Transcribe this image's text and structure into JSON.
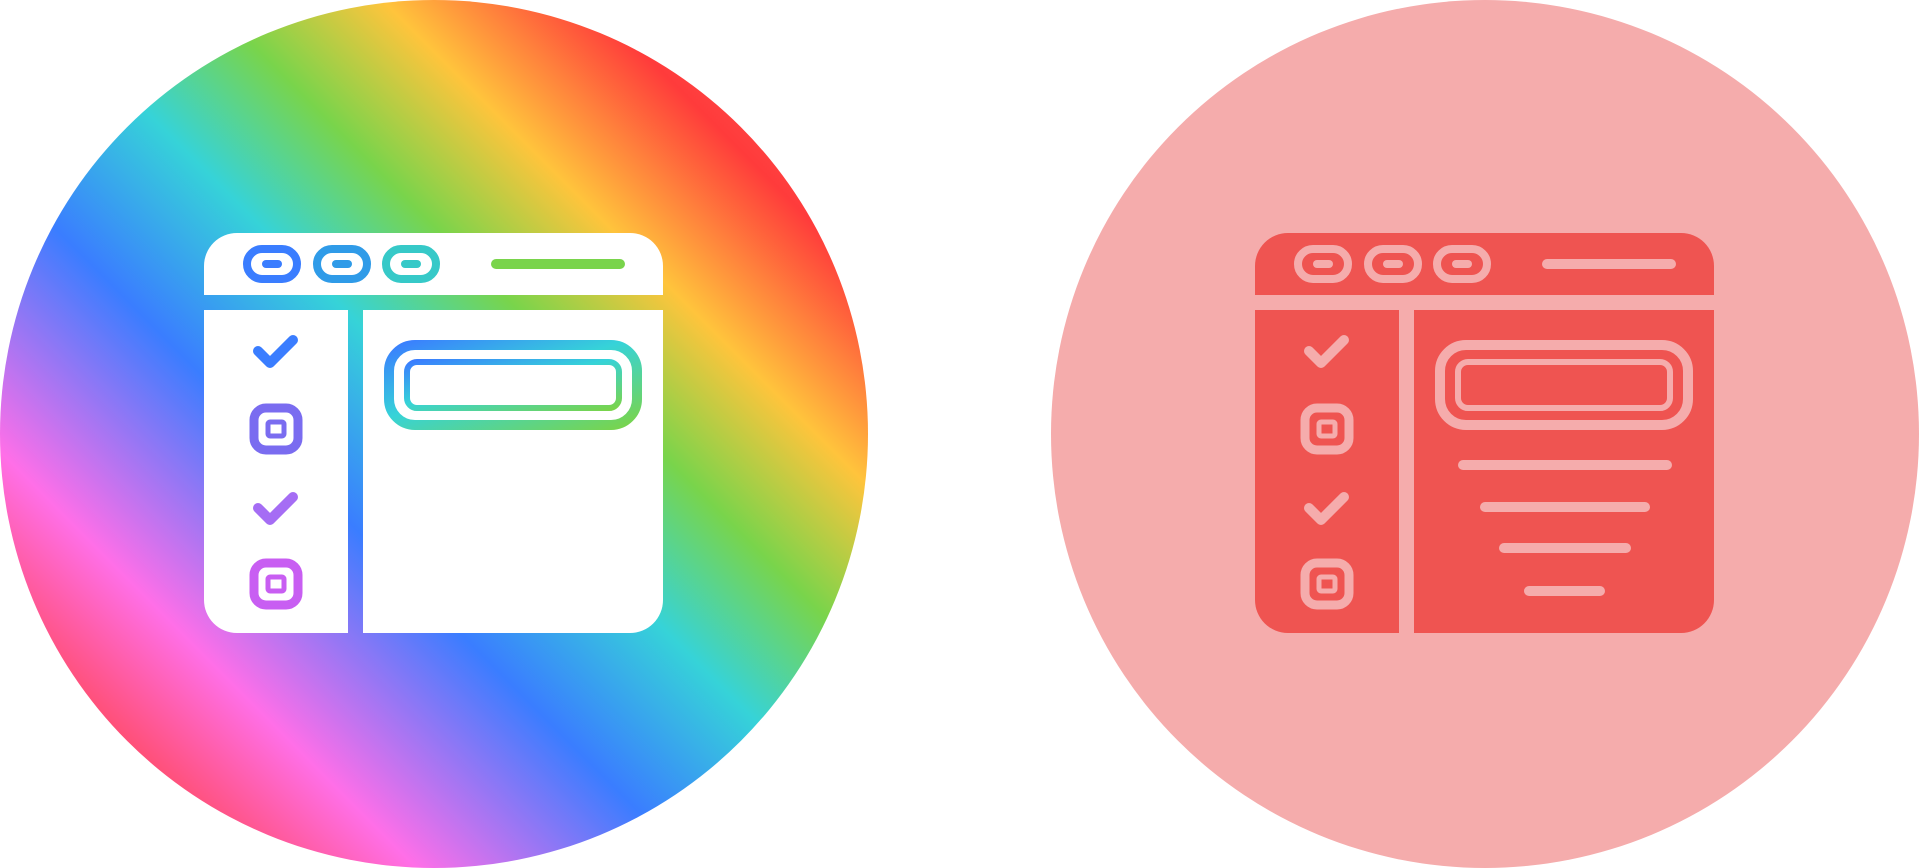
{
  "icons": [
    {
      "name": "web-checklist-icon",
      "style": "gradient",
      "background": "rainbow-gradient",
      "rainbow_stops": [
        "#7b4fd6",
        "#ff4040",
        "#ff6fe8",
        "#3a7dff",
        "#36d3d8",
        "#79d44b",
        "#ffc43c",
        "#ff3b3b",
        "#ffffff"
      ],
      "foreground": "#ffffff",
      "stroke_gradient": [
        "#3a7dff",
        "#36d3d8",
        "#79d44b",
        "#ff6fe8"
      ],
      "checklist": [
        "checked",
        "unchecked",
        "checked",
        "unchecked"
      ]
    },
    {
      "name": "web-checklist-icon",
      "style": "flat",
      "background": "#f5acac",
      "foreground": "#ef5451",
      "stroke": "#f5acac",
      "checklist": [
        "checked",
        "unchecked",
        "checked",
        "unchecked"
      ]
    }
  ]
}
